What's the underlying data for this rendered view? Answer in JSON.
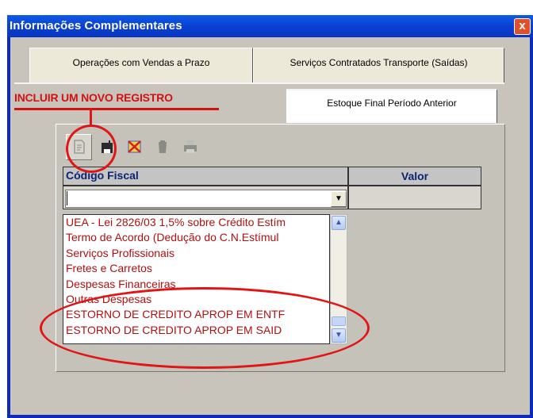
{
  "window": {
    "title": "Informações Complementares",
    "close_label": "x"
  },
  "tabs": [
    {
      "label": "Operações com Vendas a Prazo"
    },
    {
      "label": "Serviços Contratados Transporte (Saídas)"
    },
    {
      "label": "Estoque Final Período Anterior"
    }
  ],
  "annotation": {
    "incluir_label": "INCLUIR UM NOVO REGISTRO"
  },
  "toolbar": {
    "icons": [
      "new-record-icon",
      "save-icon",
      "delete-icon",
      "trash-icon",
      "print-icon"
    ]
  },
  "grid": {
    "columns": [
      "Código Fiscal",
      "Valor"
    ],
    "combo_value": "",
    "value_cell": ""
  },
  "dropdown": {
    "options": [
      "UEA - Lei 2826/03 1,5% sobre Crédito Estím",
      "Termo de Acordo  (Dedução do C.N.Estímul",
      "Serviços Profissionais",
      "Fretes e Carretos",
      "Despesas Financeiras",
      "Outras Despesas",
      "ESTORNO DE CREDITO APROP EM ENTF",
      "ESTORNO DE CREDITO APROP EM SAID"
    ]
  },
  "colors": {
    "title_bar": "#0a3fd0",
    "annotation_red": "#d41111",
    "option_text": "#b01010"
  }
}
